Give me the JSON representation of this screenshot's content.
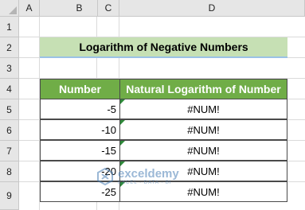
{
  "columns": [
    "A",
    "B",
    "C",
    "D"
  ],
  "rows": [
    "1",
    "2",
    "3",
    "4",
    "5",
    "6",
    "7",
    "8",
    "9"
  ],
  "title": "Logarithm of Negative Numbers",
  "table": {
    "headers": [
      "Number",
      "Natural Logarithm of Number"
    ],
    "rows": [
      {
        "number": "-5",
        "result": "#NUM!"
      },
      {
        "number": "-10",
        "result": "#NUM!"
      },
      {
        "number": "-15",
        "result": "#NUM!"
      },
      {
        "number": "-20",
        "result": "#NUM!"
      },
      {
        "number": "-25",
        "result": "#NUM!"
      }
    ]
  },
  "watermark": {
    "name": "exceldemy",
    "tagline": "EXCEL · DATA · BI"
  },
  "colors": {
    "title_fill": "#c6e0b4",
    "header_fill": "#70ad47",
    "header_text": "#ffffff",
    "title_underline": "#9bc2e6",
    "error_indicator": "#2e8b3a"
  }
}
